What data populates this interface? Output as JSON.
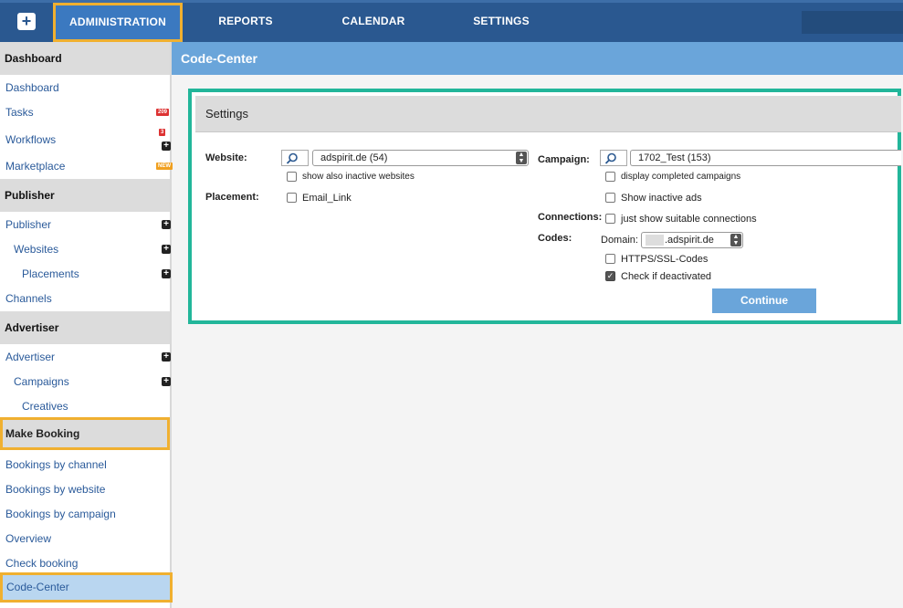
{
  "topnav": {
    "plus": "+",
    "items": [
      "ADMINISTRATION",
      "REPORTS",
      "CALENDAR",
      "SETTINGS"
    ]
  },
  "sidebar": {
    "dashboard_head": "Dashboard",
    "dashboard": "Dashboard",
    "tasks": "Tasks",
    "tasks_badge": "209",
    "workflows": "Workflows",
    "workflows_badge": "3",
    "marketplace": "Marketplace",
    "marketplace_badge": "NEW",
    "publisher_head": "Publisher",
    "publisher": "Publisher",
    "websites": "Websites",
    "placements": "Placements",
    "channels": "Channels",
    "advertiser_head": "Advertiser",
    "advertiser": "Advertiser",
    "campaigns": "Campaigns",
    "creatives": "Creatives",
    "make_booking_head": "Make Booking",
    "bookings_by_channel": "Bookings by channel",
    "bookings_by_website": "Bookings by website",
    "bookings_by_campaign": "Bookings by campaign",
    "overview": "Overview",
    "check_booking": "Check booking",
    "code_center": "Code-Center"
  },
  "page": {
    "title": "Code-Center"
  },
  "settings": {
    "title": "Settings",
    "website_label": "Website:",
    "website_value": "adspirit.de (54)",
    "show_inactive_websites": "show also inactive websites",
    "placement_label": "Placement:",
    "email_link": "Email_Link",
    "campaign_label": "Campaign:",
    "campaign_value": "1702_Test (153)",
    "display_completed_campaigns": "display completed campaigns",
    "show_inactive_ads": "Show inactive ads",
    "connections_label": "Connections:",
    "just_suitable": "just show suitable connections",
    "codes_label": "Codes:",
    "domain_label": "Domain:",
    "domain_value": ".adspirit.de",
    "https_codes": "HTTPS/SSL-Codes",
    "check_deactivated": "Check if deactivated",
    "check_deactivated_checked": true,
    "continue": "Continue"
  },
  "colors": {
    "topbar": "#2a5890",
    "header": "#6aa5da",
    "panel_border": "#22b69a",
    "highlight": "#f0b030"
  }
}
